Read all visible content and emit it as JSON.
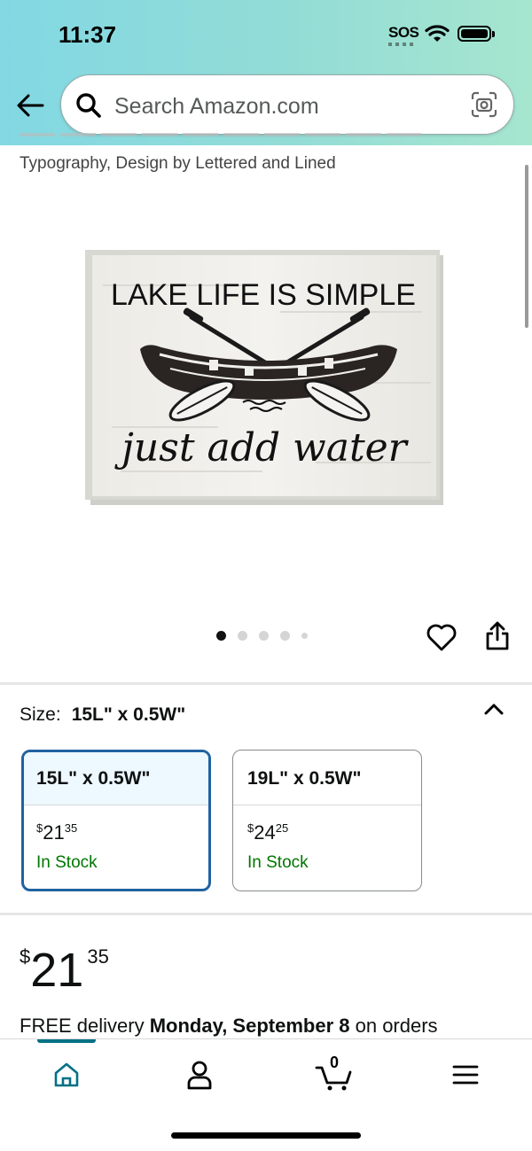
{
  "status_bar": {
    "time": "11:37",
    "sos": "SOS"
  },
  "search": {
    "placeholder": "Search Amazon.com"
  },
  "product": {
    "subtitle": "Typography, Design by Lettered and Lined",
    "image_text": {
      "line1": "LAKE LIFE IS SIMPLE",
      "line2": "just add water"
    }
  },
  "size": {
    "label": "Size:",
    "selected_value": "15L\" x 0.5W\"",
    "options": [
      {
        "name": "15L\" x 0.5W\"",
        "currency": "$",
        "price_whole": "21",
        "price_fraction": "35",
        "stock": "In Stock",
        "selected": true
      },
      {
        "name": "19L\" x 0.5W\"",
        "currency": "$",
        "price_whole": "24",
        "price_fraction": "25",
        "stock": "In Stock",
        "selected": false
      }
    ]
  },
  "price": {
    "currency": "$",
    "whole": "21",
    "fraction": "35"
  },
  "delivery": {
    "prefix": "FREE delivery",
    "date": "Monday, September 8",
    "suffix": "on orders"
  },
  "nav": {
    "cart_count": "0",
    "items": [
      "home",
      "account",
      "cart",
      "menu"
    ]
  },
  "colors": {
    "link_teal": "#007185",
    "in_stock_green": "#007600",
    "selected_border": "#2162a1"
  }
}
